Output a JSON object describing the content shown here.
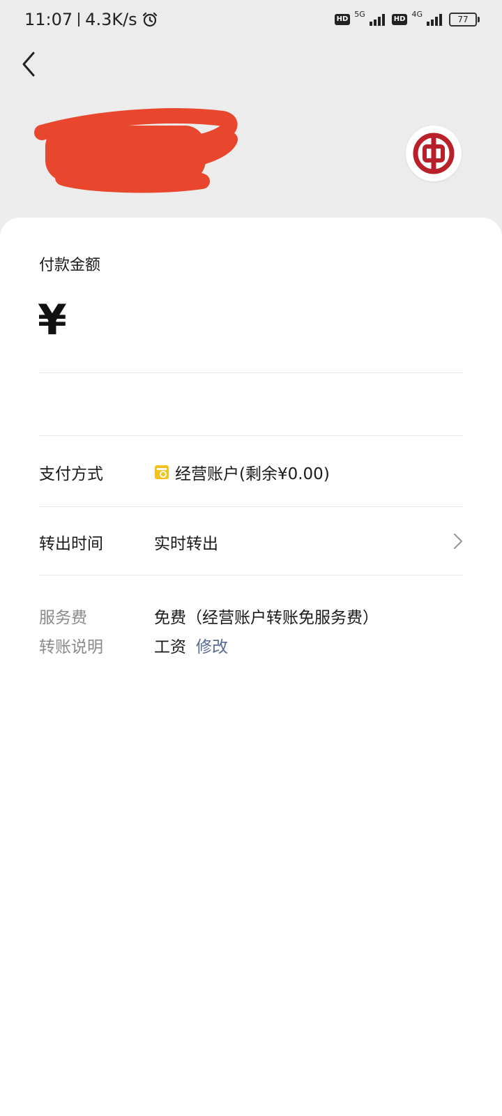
{
  "status_bar": {
    "time": "11:07",
    "speed": "4.3K/s",
    "net1": "5G",
    "net2": "4G",
    "hd": "HD",
    "battery": "77"
  },
  "amount": {
    "label": "付款金额",
    "currency_symbol": "¥"
  },
  "payment_method": {
    "label": "支付方式",
    "value": "经营账户(剩余¥0.00)",
    "icon": "wallet-icon",
    "icon_color": "#f5c11b"
  },
  "transfer_time": {
    "label": "转出时间",
    "value": "实时转出"
  },
  "service_fee": {
    "label": "服务费",
    "value": "免费（经营账户转账免服务费）"
  },
  "remark": {
    "label": "转账说明",
    "value": "工资",
    "edit_label": "修改"
  },
  "colors": {
    "background": "#ececec",
    "link": "#576b95",
    "bank_red": "#b8202a",
    "redaction": "#e8472e"
  }
}
